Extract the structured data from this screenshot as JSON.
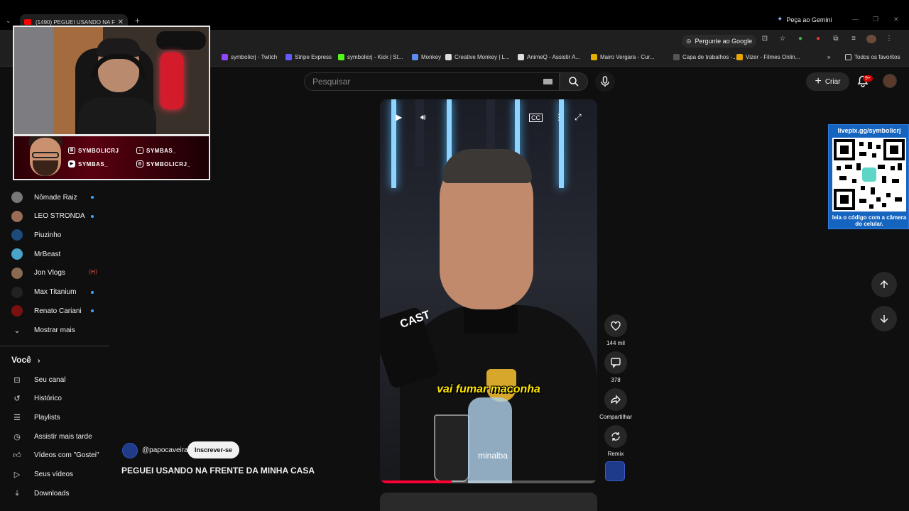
{
  "browser": {
    "tab_title": "(1490) PEGUEI USANDO NA FR...",
    "gemini_label": "Peça ao Gemini",
    "omnibox_google": "Pergunte ao Google",
    "bookmarks": [
      {
        "label": "symbolicrj - Twitch",
        "color": "#9146ff"
      },
      {
        "label": "Stripe Express",
        "color": "#635bff"
      },
      {
        "label": "symbolicrj - Kick | St...",
        "color": "#53fc18"
      },
      {
        "label": "Monkey",
        "color": "#5b8def"
      },
      {
        "label": "Creative Monkey | L...",
        "color": "#dddddd"
      },
      {
        "label": "AnimeQ - Assistir A...",
        "color": "#dddddd"
      },
      {
        "label": "Mairo Vergara - Cur...",
        "color": "#e2b100"
      },
      {
        "label": "Capa de trabalhos -...",
        "color": "#555555"
      },
      {
        "label": "Vizer - Filmes Onlin...",
        "color": "#e9a400"
      }
    ],
    "all_favorites": "Todos os favoritos"
  },
  "youtube": {
    "search_placeholder": "Pesquisar",
    "create_label": "Criar",
    "notif_badge": "9+",
    "subscriptions": [
      {
        "label": "Nômade Raiz",
        "color": "#777",
        "marker": "dot"
      },
      {
        "label": "LEO STRONDA",
        "color": "#9a6b55",
        "marker": "dot"
      },
      {
        "label": "Piuzinho",
        "color": "#1d4a7a",
        "marker": "none"
      },
      {
        "label": "MrBeast",
        "color": "#4aa3c9",
        "marker": "none"
      },
      {
        "label": "Jon Vlogs",
        "color": "#8a6a50",
        "marker": "live"
      },
      {
        "label": "Max Titanium",
        "color": "#222",
        "marker": "dot"
      },
      {
        "label": "Renato Cariani",
        "color": "#7a1010",
        "marker": "dot"
      }
    ],
    "show_more": "Mostrar mais",
    "you_heading": "Você",
    "you_items": [
      {
        "label": "Seu canal",
        "icon": "channel-icon"
      },
      {
        "label": "Histórico",
        "icon": "history-icon"
      },
      {
        "label": "Playlists",
        "icon": "playlists-icon"
      },
      {
        "label": "Assistir mais tarde",
        "icon": "watch-later-icon"
      },
      {
        "label": "Vídeos com \"Gostei\"",
        "icon": "like-icon"
      },
      {
        "label": "Seus vídeos",
        "icon": "your-videos-icon"
      },
      {
        "label": "Downloads",
        "icon": "download-icon"
      }
    ]
  },
  "short": {
    "caption": "vai fumar maconha",
    "mic_brand": "CAST",
    "bottle_label": "minalba",
    "likes": "144 mil",
    "comments": "378",
    "share_label": "Compartilhar",
    "remix_label": "Remix",
    "channel_handle": "@papocaveira",
    "subscribe_label": "Inscrever-se",
    "title": "PEGUEI USANDO NA FRENTE DA MINHA CASA",
    "progress_fraction": 0.33
  },
  "overlay": {
    "handles": [
      "SYMBOLICRJ",
      "SYMBAS_",
      "SYMBAS_",
      "SYMBOLICRJ_"
    ],
    "qr_url": "livepix.gg/symbolicrj",
    "qr_caption": "leia o código com a câmera do celular."
  }
}
